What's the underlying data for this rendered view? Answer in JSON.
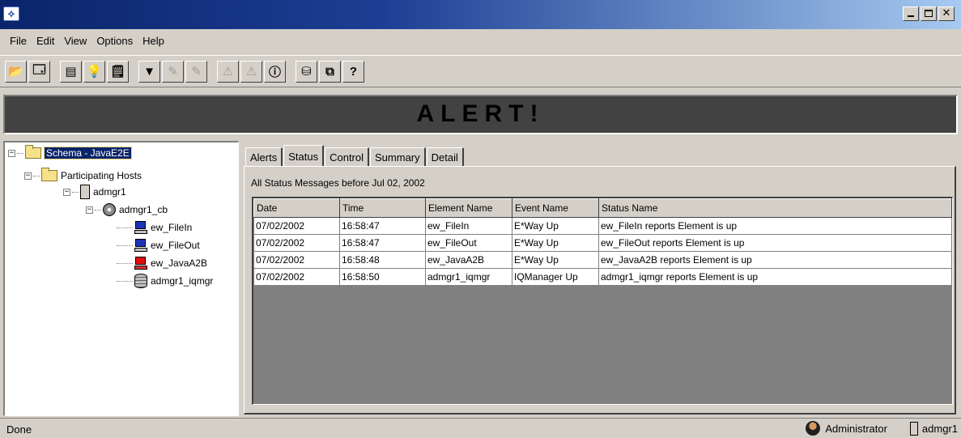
{
  "window": {
    "app_icon_glyph": "⟡"
  },
  "menu": [
    "File",
    "Edit",
    "View",
    "Options",
    "Help"
  ],
  "toolbar": {
    "groups": [
      [
        {
          "icon": "open-folder-icon",
          "glyph": "📂"
        },
        {
          "icon": "properties-icon",
          "glyph": "🗔"
        }
      ],
      [
        {
          "icon": "document-icon",
          "glyph": "▤"
        },
        {
          "icon": "lightbulb-icon",
          "glyph": "💡"
        },
        {
          "icon": "notes-icon",
          "glyph": "🗒"
        }
      ],
      [
        {
          "icon": "filter-icon",
          "glyph": "▼"
        },
        {
          "icon": "clear-filter-icon",
          "glyph": "✎",
          "disabled": true
        },
        {
          "icon": "clear-filter-all-icon",
          "glyph": "✎",
          "disabled": true
        }
      ],
      [
        {
          "icon": "warning-icon",
          "glyph": "⚠",
          "disabled": true
        },
        {
          "icon": "warning-all-icon",
          "glyph": "⚠",
          "disabled": true
        },
        {
          "icon": "info-icon",
          "glyph": "ⓘ"
        }
      ],
      [
        {
          "icon": "database-icon",
          "glyph": "⛁"
        },
        {
          "icon": "copy-icon",
          "glyph": "⧉"
        },
        {
          "icon": "help-icon",
          "glyph": "?"
        }
      ]
    ]
  },
  "alert": {
    "text": "ALERT!"
  },
  "tree": {
    "root": "Schema - JavaE2E",
    "hosts_folder": "Participating Hosts",
    "host": "admgr1",
    "control_broker": "admgr1_cb",
    "elements": [
      "ew_FileIn",
      "ew_FileOut",
      "ew_JavaA2B",
      "admgr1_iqmgr"
    ]
  },
  "tabs": [
    {
      "label": "Alerts",
      "active": false
    },
    {
      "label": "Status",
      "active": true
    },
    {
      "label": "Control",
      "active": false
    },
    {
      "label": "Summary",
      "active": false
    },
    {
      "label": "Detail",
      "active": false
    }
  ],
  "status_panel": {
    "caption": "All Status Messages before Jul 02, 2002",
    "columns": [
      "Date",
      "Time",
      "Element Name",
      "Event Name",
      "Status Name"
    ],
    "rows": [
      [
        "07/02/2002",
        "16:58:47",
        "ew_FileIn",
        "E*Way Up",
        "ew_FileIn reports Element is up"
      ],
      [
        "07/02/2002",
        "16:58:47",
        "ew_FileOut",
        "E*Way Up",
        "ew_FileOut reports Element is up"
      ],
      [
        "07/02/2002",
        "16:58:48",
        "ew_JavaA2B",
        "E*Way Up",
        "ew_JavaA2B reports Element is up"
      ],
      [
        "07/02/2002",
        "16:58:50",
        "admgr1_iqmgr",
        "IQManager Up",
        "admgr1_iqmgr reports Element is up"
      ]
    ]
  },
  "statusbar": {
    "text": "Done",
    "user": "Administrator",
    "host": "admgr1"
  }
}
